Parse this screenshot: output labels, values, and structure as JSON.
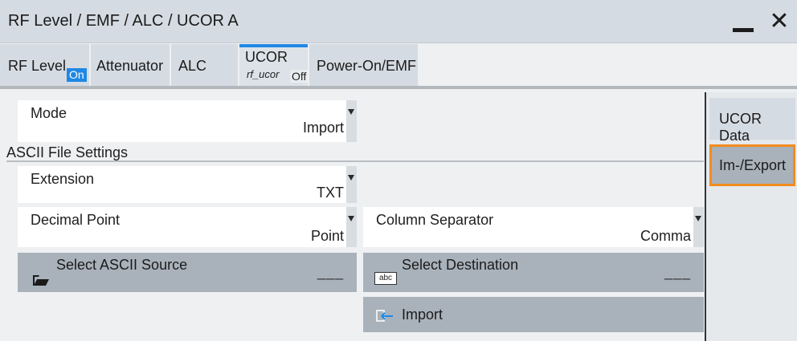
{
  "window": {
    "title": "RF Level / EMF / ALC / UCOR A",
    "minimize_icon": "minimize-icon",
    "close_icon": "close-icon",
    "close_glyph": "✕"
  },
  "tabs": {
    "rf_level": {
      "label": "RF Level",
      "badge": "On"
    },
    "attenuator": {
      "label": "Attenuator"
    },
    "alc": {
      "label": "ALC"
    },
    "ucor": {
      "label": "UCOR",
      "sublabel": "rf_ucor",
      "badge": "Off",
      "active": true
    },
    "power_on_emf": {
      "label": "Power-On/EMF"
    }
  },
  "main": {
    "mode": {
      "label": "Mode",
      "value": "Import"
    },
    "section_title": "ASCII File Settings",
    "extension": {
      "label": "Extension",
      "value": "TXT"
    },
    "decimal_point": {
      "label": "Decimal Point",
      "value": "Point"
    },
    "column_separator": {
      "label": "Column Separator",
      "value": "Comma"
    },
    "select_source": {
      "label": "Select ASCII Source",
      "value": "___",
      "icon": "folder-open-icon"
    },
    "select_destination": {
      "label": "Select Destination",
      "value": "___",
      "icon": "abc-file-icon",
      "icon_text": "abc"
    },
    "import_button": {
      "label": "Import",
      "icon": "import-icon"
    }
  },
  "side_panel": {
    "ucor_data": {
      "label": "UCOR Data"
    },
    "im_export": {
      "label": "Im-/Export",
      "active": true
    }
  },
  "colors": {
    "accent_blue": "#1e88e5",
    "focus_orange": "#f28c1c",
    "button_gray": "#a9b2bb",
    "title_bar": "#d5dbe2"
  }
}
